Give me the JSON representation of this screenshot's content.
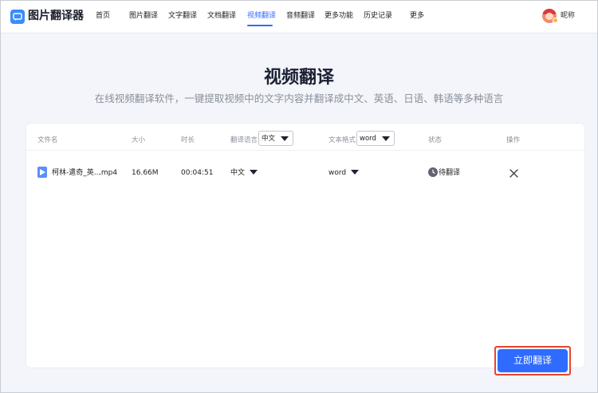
{
  "app": {
    "name": "图片翻译器",
    "brand_color": "#2f6bff"
  },
  "nav": {
    "items": [
      {
        "label": "首页"
      },
      {
        "label": "图片翻译"
      },
      {
        "label": "文字翻译"
      },
      {
        "label": "文档翻译"
      },
      {
        "label": "视频翻译",
        "active": true
      },
      {
        "label": "音频翻译"
      },
      {
        "label": "更多功能"
      },
      {
        "label": "历史记录"
      },
      {
        "label": "更多"
      }
    ]
  },
  "user": {
    "nickname": "昵称",
    "avatar_icon": "avatar-icon"
  },
  "hero": {
    "title": "视频翻译",
    "subtitle": "在线视频翻译软件，一键提取视频中的文字内容并翻译成中文、英语、日语、韩语等多种语言"
  },
  "table": {
    "headers": {
      "file_name": "文件名",
      "size": "大小",
      "duration": "时长",
      "language": "翻译语言",
      "language_select": "中文",
      "format": "文本格式",
      "format_select": "word",
      "status": "状态",
      "action": "操作"
    },
    "rows": [
      {
        "file_name": "柯林-遣奇_英...",
        "file_ext": ".mp4",
        "size": "16.66M",
        "duration": "00:04:51",
        "language": "中文",
        "format": "word",
        "status": "待翻译",
        "file_icon": "video-file-icon",
        "status_icon": "clock-icon",
        "action_icon": "close-icon"
      }
    ]
  },
  "actions": {
    "translate_now": "立即翻译",
    "highlight_color": "#e8452f"
  }
}
